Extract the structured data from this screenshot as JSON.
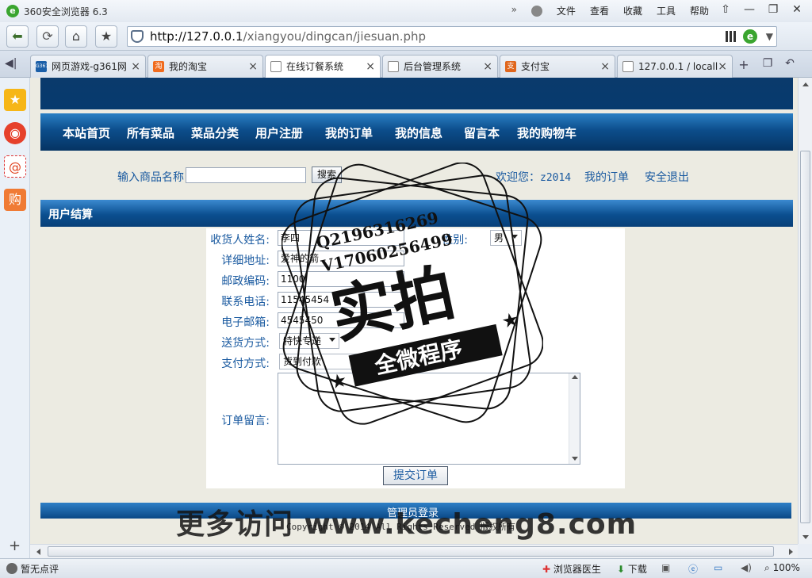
{
  "browser": {
    "app_title": "360安全浏览器 6.3",
    "app_logo": "e",
    "menu": [
      "文件",
      "查看",
      "收藏",
      "工具",
      "帮助"
    ],
    "menu_overflow": "»",
    "window_buttons": [
      "⇧",
      "—",
      "❐",
      "✕"
    ],
    "url_host": "http://127.0.0.1",
    "url_path": "/xiangyou/dingcan/jiesuan.php",
    "ext_icon_letter": "e",
    "tabs": [
      {
        "label": "网页游戏-g361网",
        "favicon": "G361",
        "favicon_color": "#1b5fa8"
      },
      {
        "label": "我的淘宝",
        "favicon": "淘",
        "favicon_color": "#f06b1e"
      },
      {
        "label": "在线订餐系统",
        "favicon": "",
        "favicon_color": "#ffffff",
        "active": true
      },
      {
        "label": "后台管理系统",
        "favicon": "",
        "favicon_color": "#ffffff"
      },
      {
        "label": "支付宝",
        "favicon": "支",
        "favicon_color": "#e0661c"
      },
      {
        "label": "127.0.0.1 / locall",
        "favicon": "",
        "favicon_color": "#ffffff"
      }
    ],
    "tab_close": "×",
    "tab_new": "+",
    "status_left": "暂无点评",
    "status_items": [
      "浏览器医生",
      "下载",
      "100%"
    ]
  },
  "site": {
    "nav": [
      "本站首页",
      "所有菜品",
      "菜品分类",
      "用户注册",
      "我的订单",
      "我的信息",
      "留言本",
      "我的购物车"
    ],
    "search_label": "输入商品名称",
    "search_button": "搜索",
    "search_value": "",
    "welcome_prefix": "欢迎您：",
    "username": "z2014",
    "link_orders": "我的订单",
    "link_logout": "安全退出",
    "section_title": "用户结算",
    "form": {
      "name_label": "收货人姓名:",
      "name_value": "李四",
      "gender_label": "性别:",
      "gender_value": "男",
      "address_label": "详细地址:",
      "address_value": "爱神的箭",
      "postcode_label": "邮政编码:",
      "postcode_value": "1100",
      "phone_label": "联系电话:",
      "phone_value": "11545454",
      "email_label": "电子邮箱:",
      "email_value": "4545450",
      "shipping_label": "送货方式:",
      "shipping_value": "特快专递",
      "payment_label": "支付方式:",
      "payment_value": "货到付款",
      "message_label": "订单留言:",
      "message_value": "",
      "submit": "提交订单"
    },
    "footer_admin": "管理员登录",
    "copyright": "Copyright © 2014 All Rights Reserved 版权所有"
  },
  "watermark": {
    "qq": "Q2196316269",
    "wechat": "V17060256499",
    "big": "实拍",
    "banner": "全微程序",
    "site_text": "更多访问 www.kecheng8.com"
  },
  "colors": {
    "nav_blue": "#0c4d8b",
    "link_blue": "#1a5aa0",
    "page_bg": "#ecebe2"
  }
}
